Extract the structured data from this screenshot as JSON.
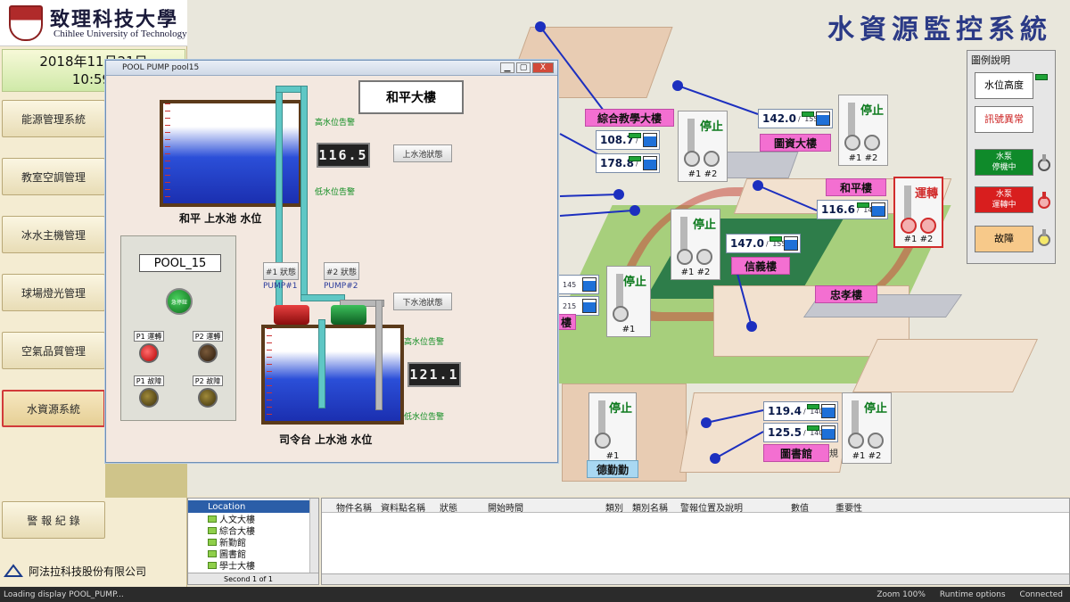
{
  "header": {
    "school_cn": "致理科技大學",
    "school_en": "Chihlee University of Technology",
    "date": "2018年11月21日",
    "time": "10:59:",
    "system_title": "水資源監控系統"
  },
  "sidebar": {
    "items": [
      {
        "label": "能源管理系統"
      },
      {
        "label": "教室空調管理"
      },
      {
        "label": "冰水主機管理"
      },
      {
        "label": "球場燈光管理"
      },
      {
        "label": "空氣品質管理"
      },
      {
        "label": "水資源系統"
      },
      {
        "label": "警 報 紀 錄"
      }
    ],
    "company": "阿法拉科技股份有限公司"
  },
  "map": {
    "buildings": [
      {
        "label": "綜合教學大樓"
      },
      {
        "label": "圖資大樓"
      },
      {
        "label": "和平樓"
      },
      {
        "label": "信義樓"
      },
      {
        "label": "忠孝樓"
      },
      {
        "label": "圖書館"
      },
      {
        "label": "樓"
      },
      {
        "label": "德勤勤"
      }
    ],
    "readings": [
      {
        "value": "108.7",
        "max": "165"
      },
      {
        "value": "178.8",
        "max": "190"
      },
      {
        "value": "142.0",
        "max": "155"
      },
      {
        "value": "116.6",
        "max": "145"
      },
      {
        "value": "147.0",
        "max": "155"
      },
      {
        "value": "119.4",
        "max": "140"
      },
      {
        "value": "125.5",
        "max": "140"
      },
      {
        "value": "",
        "max": "145"
      },
      {
        "value": "",
        "max": "215"
      }
    ],
    "pump_status": {
      "stop": "停止",
      "run": "運轉"
    },
    "pump_nums_pair": "#1 #2",
    "pump_nums_single": "#1",
    "side_fragment": "規"
  },
  "legend": {
    "title": "圖例說明",
    "water_level": "水位高度",
    "signal_error": "訊號異常",
    "pump_stopped": "水泵\n停機中",
    "pump_running": "水泵\n運轉中",
    "fault": "故障"
  },
  "pool_window": {
    "title": "POOL PUMP pool15",
    "building_label": "和平大樓",
    "upper_tank_label": "和平 上水池 水位",
    "lower_tank_label": "司令台 上水池 水位",
    "upper_reading": "116.5",
    "lower_reading": "121.1",
    "high_alarm_1": "高水位告警",
    "low_alarm_1": "低水位告警",
    "high_alarm_2": "高水位告警",
    "low_alarm_2": "低水位告警",
    "upper_btn": "上水池狀態",
    "lower_btn": "下水池狀態",
    "pump1_btn": "#1 狀態",
    "pump2_btn": "#2 狀態",
    "pump1_name": "PUMP#1",
    "pump2_name": "PUMP#2",
    "panel_name": "POOL_15",
    "panel_go": "急停鈕",
    "lamp_p1_run": "P1 運轉",
    "lamp_p2_run": "P2 運轉",
    "lamp_p1_fault": "P1 故障",
    "lamp_p2_fault": "P2 故障",
    "min": "▁",
    "max": "▢",
    "close": "X"
  },
  "tree": {
    "root": "Location",
    "items": [
      "人文大樓",
      "綜合大樓",
      "新勤館",
      "圖書館",
      "學士大樓"
    ],
    "tabs": "Second 1 of 1"
  },
  "grid": {
    "columns": [
      "物件名稱",
      "資料點名稱",
      "狀態",
      "開始時間",
      "類別",
      "類別名稱",
      "警報位置及說明",
      "數值",
      "重要性"
    ]
  },
  "status": {
    "left": "Loading display POOL_PUMP...",
    "zoom": "Zoom 100%",
    "runtime": "Runtime options",
    "connected": "Connected"
  },
  "colors": {
    "pink_label": "#f36fd1",
    "title_blue": "#2b3a86",
    "stop_green": "#0d7a1e",
    "run_red": "#d12c2c",
    "node_blue": "#1c2fbf"
  }
}
